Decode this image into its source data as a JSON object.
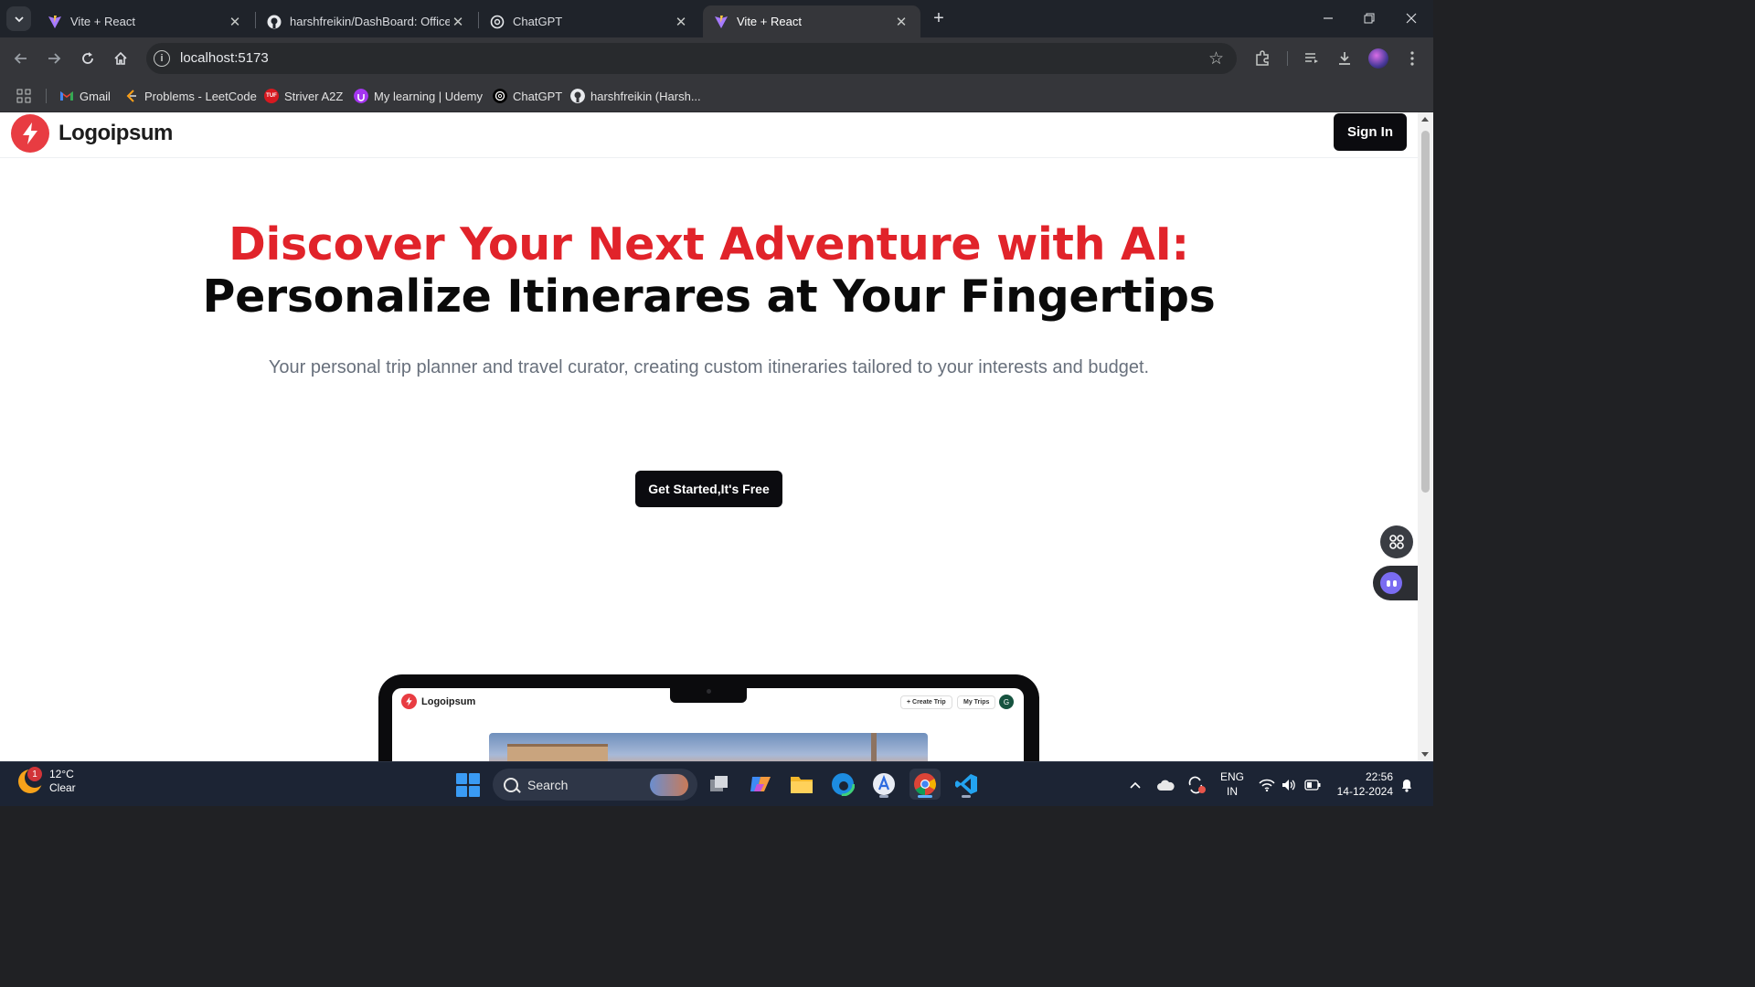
{
  "browser": {
    "tabs": [
      {
        "title": "Vite + React",
        "icon": "vite-icon",
        "active": false
      },
      {
        "title": "harshfreikin/DashBoard: Office",
        "icon": "github-icon",
        "active": false
      },
      {
        "title": "ChatGPT",
        "icon": "chatgpt-icon",
        "active": false
      },
      {
        "title": "Vite + React",
        "icon": "vite-icon",
        "active": true
      }
    ],
    "url": "localhost:5173",
    "bookmarks": [
      {
        "label": "Gmail",
        "icon": "gmail-icon"
      },
      {
        "label": "Problems - LeetCode",
        "icon": "leetcode-icon"
      },
      {
        "label": "Striver A2Z",
        "icon": "tuf-icon",
        "icon_text": "TUF"
      },
      {
        "label": "My learning | Udemy",
        "icon": "udemy-icon"
      },
      {
        "label": "ChatGPT",
        "icon": "chatgpt-icon"
      },
      {
        "label": "harshfreikin (Harsh...",
        "icon": "github-icon"
      }
    ]
  },
  "site": {
    "logo_text": "Logoipsum",
    "sign_in_label": "Sign In",
    "hero_line1": "Discover Your Next Adventure with AI:",
    "hero_line2": "Personalize Itinerares at Your Fingertips",
    "subtitle": "Your personal trip planner and travel curator, creating custom itineraries tailored to your interests and budget.",
    "cta_label": "Get Started,It's Free",
    "preview": {
      "logo_text": "Logoipsum",
      "create_trip_label": "+ Create Trip",
      "my_trips_label": "My Trips",
      "avatar_initial": "G"
    },
    "colors": {
      "accent_red": "#e1232a",
      "dark": "#0b0b0f"
    }
  },
  "taskbar": {
    "weather_temp": "12°C",
    "weather_text": "Clear",
    "weather_badge": "1",
    "search_placeholder": "Search",
    "lang_line1": "ENG",
    "lang_line2": "IN",
    "time": "22:56",
    "date": "14-12-2024"
  }
}
